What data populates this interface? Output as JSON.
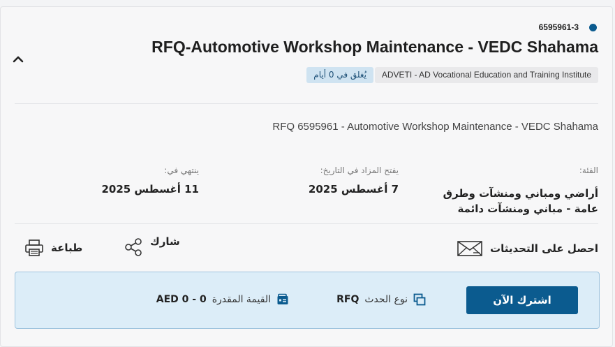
{
  "rfq": {
    "id": "6595961-3",
    "title": "RFQ-Automotive Workshop Maintenance - VEDC Shahama",
    "organization": "ADVETI - AD Vocational Education and Training Institute",
    "closing_badge": "يُغلق في 0 أيام",
    "description": "RFQ 6595961 - Automotive Workshop Maintenance - VEDC Shahama"
  },
  "meta": {
    "category_label": "الفئة:",
    "category_value": "أراضي ومباني ومنشآت وطرق عامة - مباني ومنشآت دائمة",
    "opens_label": "يفتح المزاد في التاريخ:",
    "opens_value": "7 أغسطس 2025",
    "ends_label": "ينتهي في:",
    "ends_value": "11 أغسطس 2025"
  },
  "actions": {
    "updates_label": "احصل على التحديثات",
    "share_label": "شارك",
    "print_label": "طباعة"
  },
  "banner": {
    "subscribe_label": "اشترك الآن",
    "event_type_label": "نوع الحدث",
    "event_type_value": "RFQ",
    "estimated_value_label": "القيمة المقدرة",
    "estimated_value_value": "AED 0 - 0"
  },
  "colors": {
    "primary": "#0b5b8f",
    "banner_bg": "#dcedf8",
    "badge_bg": "#cfe3f1"
  }
}
